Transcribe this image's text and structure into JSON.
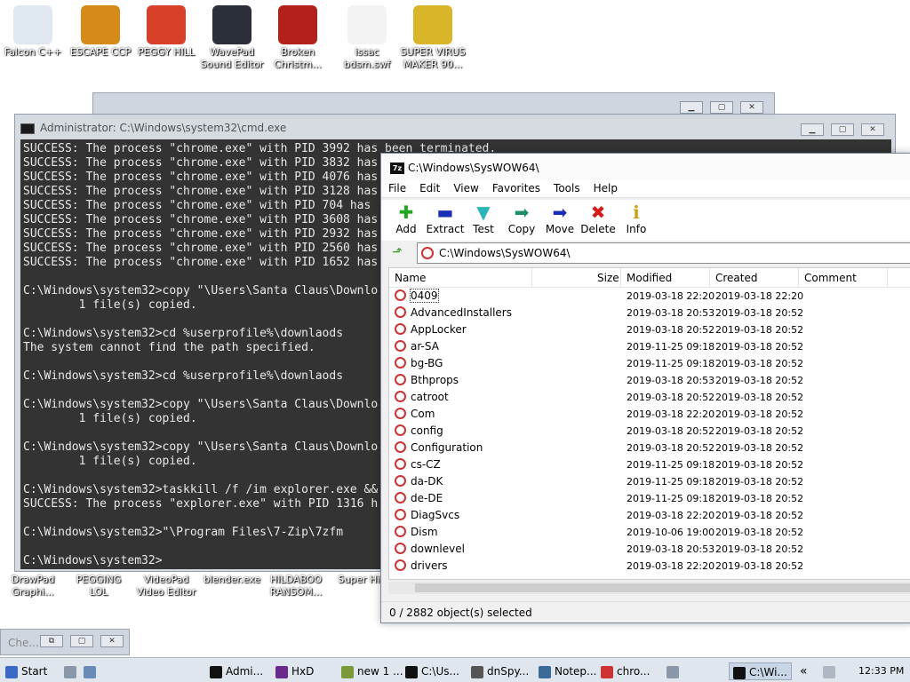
{
  "desktop_icons_top": [
    {
      "label": "Falcon C++",
      "color": "#dfe8f0"
    },
    {
      "label": "ESCAPE CCP",
      "color": "#d68a1a"
    },
    {
      "label": "PEGGY HILL",
      "color": "#d8402a"
    },
    {
      "label": "WavePad Sound Editor",
      "color": "#2a2f3a"
    },
    {
      "label": "Broken Christm...",
      "color": "#b3211a"
    },
    {
      "label": "issac bdsm.swf",
      "color": "#f3f3f3"
    },
    {
      "label": "SUPER VIRUS MAKER 90...",
      "color": "#d9b52a"
    }
  ],
  "desktop_icons_bottom": [
    {
      "label": "DrawPad Graphi...",
      "color": "#2d7fd2"
    },
    {
      "label": "PEGGING LOL",
      "color": "#b3211a"
    },
    {
      "label": "VideoPad Video Editor",
      "color": "#2a2f3a"
    },
    {
      "label": "blender.exe",
      "color": "#e38a1a"
    },
    {
      "label": "HILDABOO RANSOM...",
      "color": "#3a6ac6"
    },
    {
      "label": "Super Hi...",
      "color": "#c33"
    }
  ],
  "cmd": {
    "title": "Administrator: C:\\Windows\\system32\\cmd.exe",
    "lines": [
      "SUCCESS: The process \"chrome.exe\" with PID 3992 has been terminated.",
      "SUCCESS: The process \"chrome.exe\" with PID 3832 has",
      "SUCCESS: The process \"chrome.exe\" with PID 4076 has",
      "SUCCESS: The process \"chrome.exe\" with PID 3128 has",
      "SUCCESS: The process \"chrome.exe\" with PID 704 has",
      "SUCCESS: The process \"chrome.exe\" with PID 3608 has",
      "SUCCESS: The process \"chrome.exe\" with PID 2932 has",
      "SUCCESS: The process \"chrome.exe\" with PID 2560 has",
      "SUCCESS: The process \"chrome.exe\" with PID 1652 has",
      "",
      "C:\\Windows\\system32>copy \"\\Users\\Santa Claus\\Downlo",
      "        1 file(s) copied.",
      "",
      "C:\\Windows\\system32>cd %userprofile%\\downlaods",
      "The system cannot find the path specified.",
      "",
      "C:\\Windows\\system32>cd %userprofile%\\downlaods",
      "",
      "C:\\Windows\\system32>copy \"\\Users\\Santa Claus\\Downlo",
      "        1 file(s) copied.",
      "",
      "C:\\Windows\\system32>copy \"\\Users\\Santa Claus\\Downlo",
      "        1 file(s) copied.",
      "",
      "C:\\Windows\\system32>taskkill /f /im explorer.exe &&",
      "SUCCESS: The process \"explorer.exe\" with PID 1316 h",
      "",
      "C:\\Windows\\system32>\"\\Program Files\\7-Zip\\7zfm",
      "",
      "C:\\Windows\\system32>"
    ]
  },
  "zip": {
    "title": "C:\\Windows\\SysWOW64\\",
    "menu": [
      "File",
      "Edit",
      "View",
      "Favorites",
      "Tools",
      "Help"
    ],
    "tools": [
      {
        "label": "Add",
        "glyph": "✚",
        "color": "#1fa81f"
      },
      {
        "label": "Extract",
        "glyph": "▬",
        "color": "#1a2fb8"
      },
      {
        "label": "Test",
        "glyph": "▼",
        "color": "#2ab6b6"
      },
      {
        "label": "Copy",
        "glyph": "➡",
        "color": "#1c8f6a"
      },
      {
        "label": "Move",
        "glyph": "➡",
        "color": "#1a2fb8"
      },
      {
        "label": "Delete",
        "glyph": "✖",
        "color": "#d41a1a"
      },
      {
        "label": "Info",
        "glyph": "ℹ",
        "color": "#c9a21a"
      }
    ],
    "address": "C:\\Windows\\SysWOW64\\",
    "columns": {
      "name": "Name",
      "size": "Size",
      "modified": "Modified",
      "created": "Created",
      "comment": "Comment"
    },
    "rows": [
      {
        "name": "0409",
        "modified": "2019-03-18 22:20",
        "created": "2019-03-18 22:20"
      },
      {
        "name": "AdvancedInstallers",
        "modified": "2019-03-18 20:53",
        "created": "2019-03-18 20:52"
      },
      {
        "name": "AppLocker",
        "modified": "2019-03-18 20:52",
        "created": "2019-03-18 20:52"
      },
      {
        "name": "ar-SA",
        "modified": "2019-11-25 09:18",
        "created": "2019-03-18 20:52"
      },
      {
        "name": "bg-BG",
        "modified": "2019-11-25 09:18",
        "created": "2019-03-18 20:52"
      },
      {
        "name": "Bthprops",
        "modified": "2019-03-18 20:53",
        "created": "2019-03-18 20:52"
      },
      {
        "name": "catroot",
        "modified": "2019-03-18 20:52",
        "created": "2019-03-18 20:52"
      },
      {
        "name": "Com",
        "modified": "2019-03-18 22:20",
        "created": "2019-03-18 20:52"
      },
      {
        "name": "config",
        "modified": "2019-03-18 20:52",
        "created": "2019-03-18 20:52"
      },
      {
        "name": "Configuration",
        "modified": "2019-03-18 20:52",
        "created": "2019-03-18 20:52"
      },
      {
        "name": "cs-CZ",
        "modified": "2019-11-25 09:18",
        "created": "2019-03-18 20:52"
      },
      {
        "name": "da-DK",
        "modified": "2019-11-25 09:18",
        "created": "2019-03-18 20:52"
      },
      {
        "name": "de-DE",
        "modified": "2019-11-25 09:18",
        "created": "2019-03-18 20:52"
      },
      {
        "name": "DiagSvcs",
        "modified": "2019-03-18 22:20",
        "created": "2019-03-18 20:52"
      },
      {
        "name": "Dism",
        "modified": "2019-10-06 19:00",
        "created": "2019-03-18 20:52"
      },
      {
        "name": "downlevel",
        "modified": "2019-03-18 20:53",
        "created": "2019-03-18 20:52"
      },
      {
        "name": "drivers",
        "modified": "2019-03-18 22:20",
        "created": "2019-03-18 20:52"
      }
    ],
    "status": "0 / 2882 object(s) selected"
  },
  "small_window": {
    "title": "Che..."
  },
  "taskbar": {
    "start": "Start",
    "items": [
      {
        "label": "Admi...",
        "color": "#111"
      },
      {
        "label": "HxD",
        "color": "#6a2a8a"
      },
      {
        "label": "new 1 ...",
        "color": "#7a9a3a"
      },
      {
        "label": "C:\\Us...",
        "color": "#111"
      },
      {
        "label": "dnSpy...",
        "color": "#555"
      },
      {
        "label": "Notep...",
        "color": "#3a6a9a"
      },
      {
        "label": "chro...",
        "color": "#c33"
      },
      {
        "label": "C:\\Wi...",
        "color": "#111"
      }
    ],
    "clock": "12:33 PM"
  }
}
